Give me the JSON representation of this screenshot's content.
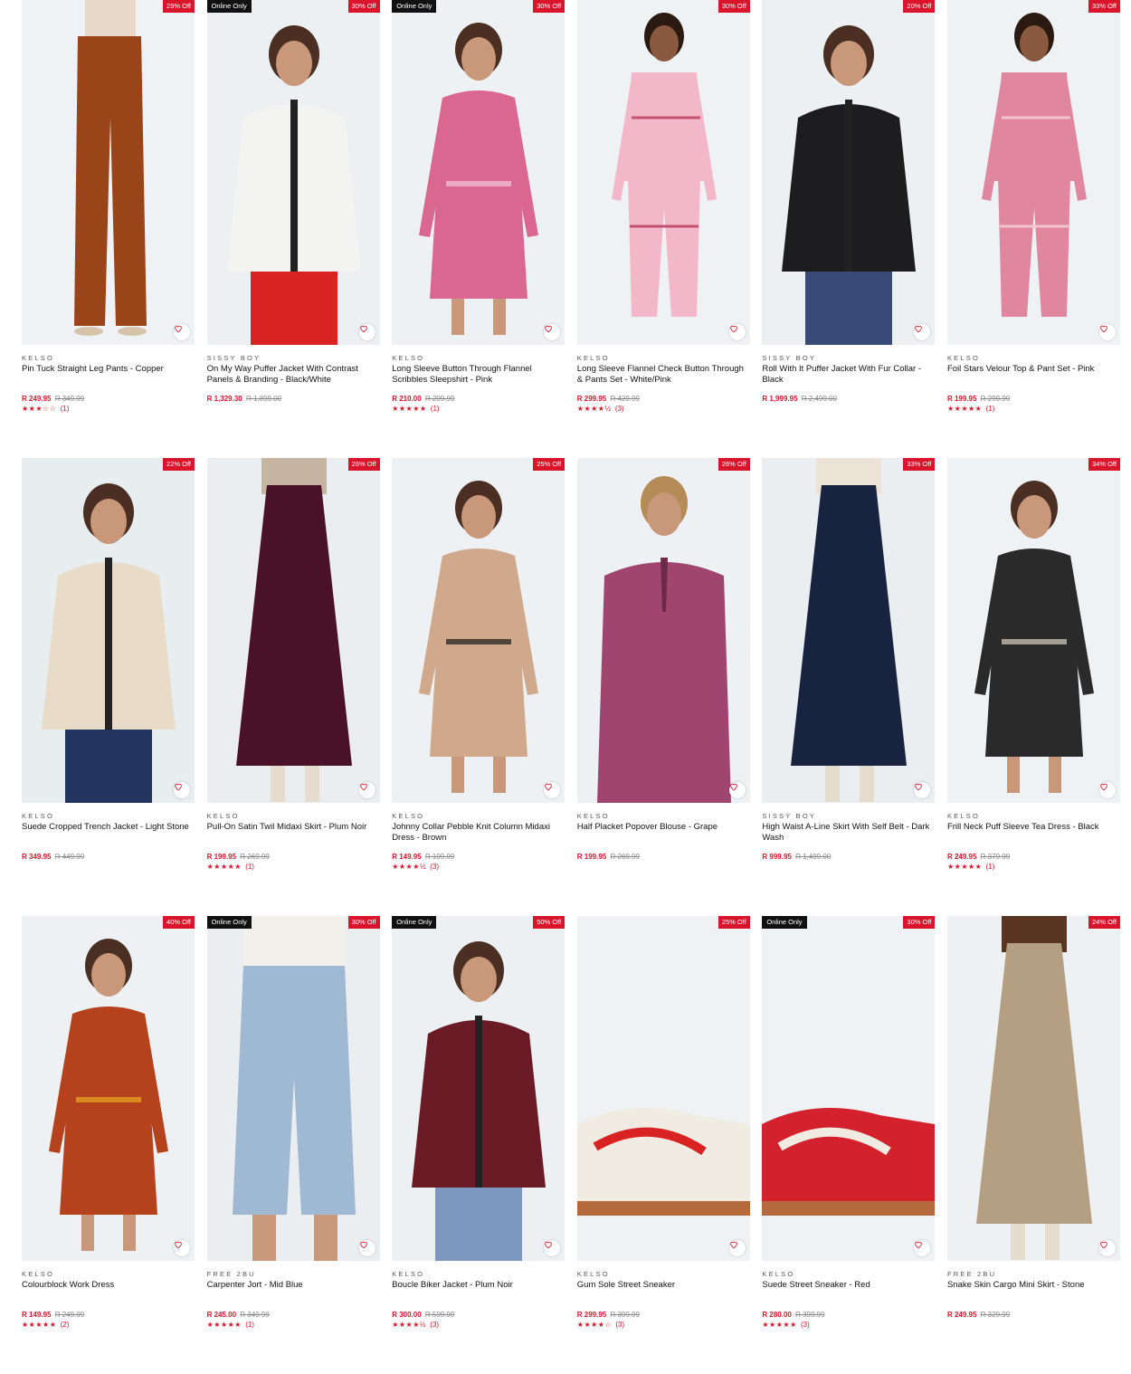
{
  "products": [
    {
      "brand": "KELSO",
      "title": "Pin Tuck Straight Leg Pants - Copper",
      "price": "R 249.95",
      "was": "R 349.99",
      "discount": "29% Off",
      "online_only": false,
      "stars": "★★★☆☆",
      "rating_count": "(1)",
      "rating_value": 3.5,
      "palette": {
        "bg": "#eef2f4",
        "main": "#9a4419",
        "accent": "#e7d8c8"
      },
      "kind": "pants"
    },
    {
      "brand": "SISSY BOY",
      "title": "On My Way Puffer Jacket With Contrast Panels & Branding - Black/White",
      "price": "R 1,329.30",
      "was": "R 1,899.00",
      "discount": "30% Off",
      "online_only": true,
      "online_label": "Online Only",
      "stars": "",
      "rating_count": "",
      "palette": {
        "bg": "#edf0f2",
        "main": "#f3f3f1",
        "accent": "#d92323"
      },
      "kind": "jacket"
    },
    {
      "brand": "KELSO",
      "title": "Long Sleeve Button Through Flannel Scribbles Sleepshirt - Pink",
      "price": "R 210.00",
      "was": "R 299.99",
      "discount": "30% Off",
      "online_only": true,
      "online_label": "Online Only",
      "stars": "★★★★★",
      "rating_count": "(1)",
      "palette": {
        "bg": "#eef1f3",
        "main": "#d9678f",
        "accent": "#f2c7d5"
      },
      "kind": "dress"
    },
    {
      "brand": "KELSO",
      "title": "Long Sleeve Flannel Check Button Through & Pants Set - White/Pink",
      "price": "R 299.95",
      "was": "R 429.99",
      "discount": "30% Off",
      "online_only": false,
      "stars": "★★★★½",
      "rating_count": "(3)",
      "palette": {
        "bg": "#eef2f4",
        "main": "#f2b7c8",
        "accent": "#c25274"
      },
      "kind": "set"
    },
    {
      "brand": "SISSY BOY",
      "title": "Roll With It Puffer Jacket With Fur Collar - Black",
      "price": "R 1,999.95",
      "was": "R 2,499.00",
      "discount": "20% Off",
      "online_only": false,
      "stars": "",
      "rating_count": "",
      "palette": {
        "bg": "#edf0f2",
        "main": "#1d1d20",
        "accent": "#3a4a78"
      },
      "kind": "jacket"
    },
    {
      "brand": "KELSO",
      "title": "Foil Stars Velour Top & Pant Set - Pink",
      "price": "R 199.95",
      "was": "R 299.99",
      "discount": "33% Off",
      "online_only": false,
      "stars": "★★★★★",
      "rating_count": "(1)",
      "palette": {
        "bg": "#eef2f4",
        "main": "#e1869f",
        "accent": "#f3c3d0"
      },
      "kind": "set"
    },
    {
      "brand": "KELSO",
      "title": "Suede Cropped Trench Jacket - Light Stone",
      "price": "R 349.95",
      "was": "R 449.99",
      "discount": "22% Off",
      "online_only": false,
      "stars": "",
      "rating_count": "",
      "palette": {
        "bg": "#e8edf0",
        "main": "#e8dcc8",
        "accent": "#23355e"
      },
      "kind": "jacket"
    },
    {
      "brand": "KELSO",
      "title": "Pull-On Satin Twil Midaxi Skirt - Plum Noir",
      "price": "R 199.95",
      "was": "R 269.99",
      "discount": "26% Off",
      "online_only": false,
      "stars": "★★★★★",
      "rating_count": "(1)",
      "palette": {
        "bg": "#eaeef1",
        "main": "#4a1229",
        "accent": "#c7b5a3"
      },
      "kind": "skirt"
    },
    {
      "brand": "KELSO",
      "title": "Johnny Collar Pebble Knit Column Midaxi Dress - Brown",
      "price": "R 149.95",
      "was": "R 199.99",
      "discount": "25% Off",
      "online_only": false,
      "stars": "★★★★½",
      "rating_count": "(3)",
      "palette": {
        "bg": "#eef1f3",
        "main": "#d0a88c",
        "accent": "#1a1a1a"
      },
      "kind": "dress"
    },
    {
      "brand": "KELSO",
      "title": "Half Placket Popover Blouse - Grape",
      "price": "R 199.95",
      "was": "R 269.99",
      "discount": "26% Off",
      "online_only": false,
      "stars": "",
      "rating_count": "",
      "palette": {
        "bg": "#eef1f3",
        "main": "#a04470",
        "accent": "#1b1b2a"
      },
      "kind": "blouse"
    },
    {
      "brand": "SISSY BOY",
      "title": "High Waist A-Line Skirt With Self Belt - Dark Wash",
      "price": "R 999.95",
      "was": "R 1,499.00",
      "discount": "33% Off",
      "online_only": false,
      "stars": "",
      "rating_count": "",
      "palette": {
        "bg": "#eaeef1",
        "main": "#18233f",
        "accent": "#ece3d6"
      },
      "kind": "skirt"
    },
    {
      "brand": "KELSO",
      "title": "Frill Neck Puff Sleeve Tea Dress - Black",
      "price": "R 249.95",
      "was": "R 379.99",
      "discount": "34% Off",
      "online_only": false,
      "stars": "★★★★★",
      "rating_count": "(1)",
      "palette": {
        "bg": "#eef2f4",
        "main": "#2a2a2a",
        "accent": "#d8cfbd"
      },
      "kind": "dress"
    },
    {
      "brand": "KELSO",
      "title": "Colourblock Work Dress",
      "price": "R 149.95",
      "was": "R 249.99",
      "discount": "40% Off",
      "online_only": false,
      "stars": "★★★★★",
      "rating_count": "(2)",
      "palette": {
        "bg": "#eef1f3",
        "main": "#b4431d",
        "accent": "#e9a722"
      },
      "kind": "dress"
    },
    {
      "brand": "FREE 2BU",
      "title": "Carpenter Jort - Mid Blue",
      "price": "R 245.00",
      "was": "R 349.99",
      "discount": "30% Off",
      "online_only": true,
      "online_label": "Online Only",
      "stars": "★★★★★",
      "rating_count": "(1)",
      "palette": {
        "bg": "#eaeef1",
        "main": "#9fb9d3",
        "accent": "#f2f0ea"
      },
      "kind": "shorts"
    },
    {
      "brand": "KELSO",
      "title": "Boucle Biker Jacket - Plum Noir",
      "price": "R 300.00",
      "was": "R 599.99",
      "discount": "50% Off",
      "online_only": true,
      "online_label": "Online Only",
      "stars": "★★★★½",
      "rating_count": "(3)",
      "palette": {
        "bg": "#edf0f2",
        "main": "#6a1b26",
        "accent": "#7d98bf"
      },
      "kind": "jacket"
    },
    {
      "brand": "KELSO",
      "title": "Gum Sole Street Sneaker",
      "price": "R 299.95",
      "was": "R 399.99",
      "discount": "25% Off",
      "online_only": false,
      "stars": "★★★★☆",
      "rating_count": "(3)",
      "palette": {
        "bg": "#eef2f4",
        "main": "#f1ece2",
        "accent": "#d92323"
      },
      "kind": "sneaker"
    },
    {
      "brand": "KELSO",
      "title": "Suede Street Sneaker - Red",
      "price": "R 280.00",
      "was": "R 399.99",
      "discount": "30% Off",
      "online_only": true,
      "online_label": "Online Only",
      "stars": "★★★★★",
      "rating_count": "(3)",
      "palette": {
        "bg": "#eef2f4",
        "main": "#d3222d",
        "accent": "#f1ece2"
      },
      "kind": "sneaker"
    },
    {
      "brand": "FREE 2BU",
      "title": "Snake Skin Cargo Mini Skirt - Stone",
      "price": "R 249.95",
      "was": "R 329.99",
      "discount": "24% Off",
      "online_only": false,
      "stars": "",
      "rating_count": "",
      "palette": {
        "bg": "#eef1f3",
        "main": "#b59f83",
        "accent": "#5a3522"
      },
      "kind": "skirt"
    }
  ],
  "icons": {
    "wishlist": "heart-outline-icon"
  },
  "colors": {
    "sale_red": "#d9142b",
    "online_badge": "#111111"
  }
}
